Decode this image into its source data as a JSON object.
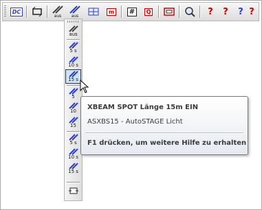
{
  "toolbar": {
    "buttons": [
      {
        "icon": "dc-icon",
        "text": "DC"
      },
      {
        "icon": "loop-icon",
        "text": ""
      },
      {
        "icon": "spot-aus-icon",
        "text": "aus"
      },
      {
        "icon": "spot-aus-icon-2",
        "text": "aus"
      },
      {
        "icon": "multi-icon",
        "text": "m"
      },
      {
        "icon": "grid-icon",
        "text": "#"
      },
      {
        "icon": "query-icon",
        "text": "Q"
      },
      {
        "icon": "frame-icon",
        "text": ""
      },
      {
        "icon": "magnifier-icon",
        "text": ""
      },
      {
        "icon": "help-red-icon",
        "text": "?"
      },
      {
        "icon": "help-red-icon-2",
        "text": "?"
      },
      {
        "icon": "help-color-icon",
        "text": "?"
      },
      {
        "icon": "help-red-icon-3",
        "text": "?"
      }
    ]
  },
  "palette": {
    "buttons": [
      {
        "name": "spot-aus-button",
        "label": "aus"
      },
      {
        "name": "spot-5s-button",
        "label": "5 s"
      },
      {
        "name": "spot-10s-button",
        "label": "10 s"
      },
      {
        "name": "spot-15s-button",
        "label": "15 s"
      },
      {
        "name": "spot-5-button",
        "label": "5"
      },
      {
        "name": "spot-10-button",
        "label": "10"
      },
      {
        "name": "spot-15-button",
        "label": "15"
      },
      {
        "name": "spot-5s-b-button",
        "label": "5 s"
      },
      {
        "name": "spot-10s-b-button",
        "label": "10 s"
      },
      {
        "name": "spot-15s-b-button",
        "label": "15 s"
      }
    ],
    "selected": "15 s"
  },
  "tooltip": {
    "title": "XBEAM SPOT Länge 15m EIN",
    "subtitle": "ASXBS15 - AutoSTAGE Licht",
    "help": "F1 drücken, um weitere Hilfe zu erhalten"
  },
  "colors": {
    "tooltip_border": "#767676",
    "selected_bg": "#cfe3f7",
    "icon_blue": "#2a3fd1"
  }
}
